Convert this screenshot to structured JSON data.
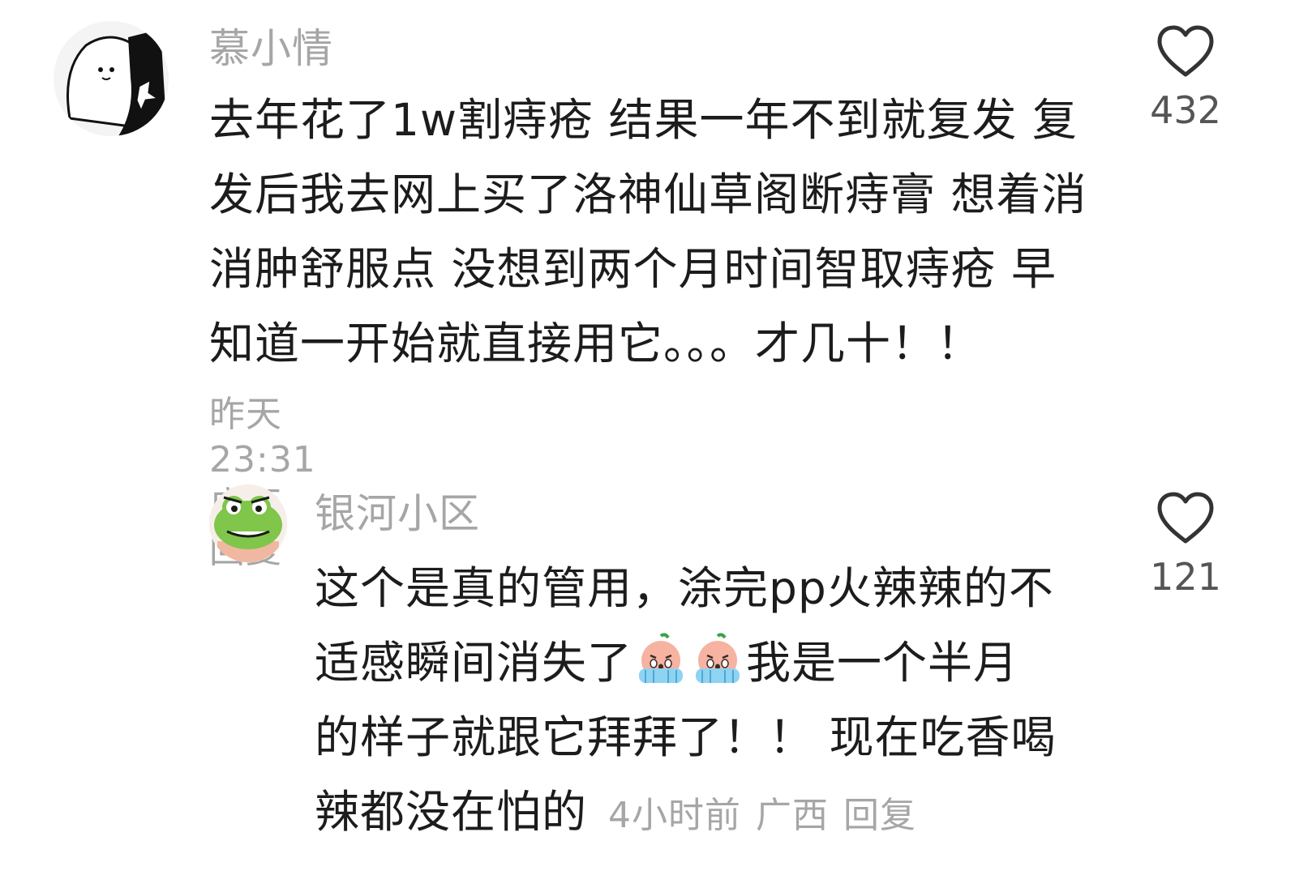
{
  "comments": [
    {
      "username": "慕小情",
      "lines": [
        "去年花了1w割痔疮 结果一年不到就复发 复",
        "发后我去网上买了洛神仙草阁断痔膏 想着消",
        "消肿舒服点 没想到两个月时间智取痔疮 早",
        "知道一开始就直接用它。。。才几十！！"
      ],
      "time": "昨天 23:31",
      "location": "广西",
      "reply_label": "回复",
      "likes": "432"
    },
    {
      "username": "银河小区",
      "line1": "这个是真的管用，涂完pp火辣辣的不",
      "line2_before": "适感瞬间消失了",
      "line2_after": "我是一个半月",
      "line3": "的样子就跟它拜拜了！！ 现在吃香喝",
      "line4": "辣都没在怕的",
      "time": "4小时前",
      "location": "广西",
      "reply_label": "回复",
      "likes": "121",
      "emoji": "crying-peach-emoji"
    }
  ],
  "colors": {
    "muted": "#a6a6a6",
    "text": "#1c1c1c",
    "like_outline": "#333333"
  }
}
